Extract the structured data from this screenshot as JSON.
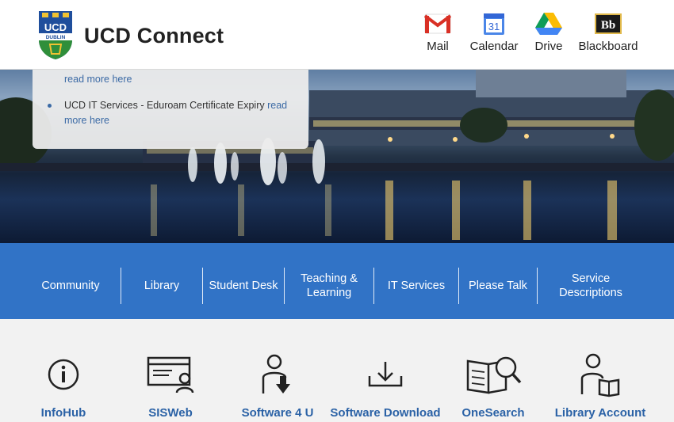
{
  "header": {
    "crest_text": "UCD",
    "crest_subtext": "DUBLIN",
    "title": "UCD Connect",
    "apps": [
      {
        "label": "Mail",
        "icon": "gmail-icon"
      },
      {
        "label": "Calendar",
        "icon": "calendar-icon",
        "badge": "31"
      },
      {
        "label": "Drive",
        "icon": "drive-icon"
      },
      {
        "label": "Blackboard",
        "icon": "blackboard-icon",
        "badge": "Bb"
      }
    ]
  },
  "news": {
    "items": [
      {
        "text": "",
        "link": "read more here"
      },
      {
        "text": "UCD IT Services - Eduroam Certificate Expiry ",
        "link": "read more here"
      }
    ]
  },
  "nav": {
    "items": [
      {
        "label": "Community"
      },
      {
        "label": "Library"
      },
      {
        "label": "Student Desk"
      },
      {
        "label": "Teaching & Learning"
      },
      {
        "label": "IT Services"
      },
      {
        "label": "Please Talk"
      },
      {
        "label": "Service Descriptions"
      }
    ]
  },
  "tiles": [
    {
      "label": "InfoHub",
      "icon": "info-icon"
    },
    {
      "label": "SISWeb",
      "icon": "web-profile-icon"
    },
    {
      "label": "Software 4 U",
      "icon": "person-download-icon"
    },
    {
      "label": "Software Download",
      "icon": "download-tray-icon"
    },
    {
      "label": "OneSearch",
      "icon": "book-search-icon"
    },
    {
      "label": "Library Account",
      "icon": "person-book-icon"
    }
  ],
  "colors": {
    "nav_background": "#3173c6",
    "link": "#2b62a6",
    "header_background": "#ffffff"
  }
}
